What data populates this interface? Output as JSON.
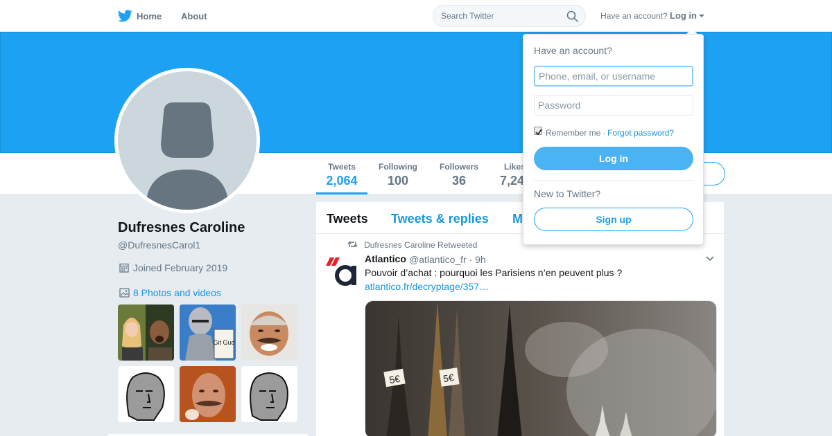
{
  "nav": {
    "home": "Home",
    "about": "About",
    "search_placeholder": "Search Twitter",
    "have_account": "Have an account?",
    "login": "Log in"
  },
  "profile": {
    "name": "Dufresnes Caroline",
    "handle": "@DufresnesCarol1",
    "joined": "Joined February 2019",
    "photos": "8 Photos and videos"
  },
  "stats": [
    {
      "label": "Tweets",
      "value": "2,064"
    },
    {
      "label": "Following",
      "value": "100"
    },
    {
      "label": "Followers",
      "value": "36"
    },
    {
      "label": "Likes",
      "value": "7,24"
    }
  ],
  "tabs": [
    "Tweets",
    "Tweets & replies",
    "M"
  ],
  "tweet": {
    "retweeted_by": "Dufresnes Caroline Retweeted",
    "author": "Atlantico",
    "meta": "@atlantico_fr · 9h",
    "text": "Pouvoir d’achat : pourquoi les Parisiens n’en peuvent plus ?",
    "link": "atlantico.fr/decryptage/357…",
    "price_tag": "5€"
  },
  "thumbs": {
    "git_gud": "Git Gud"
  },
  "login_dropdown": {
    "title": "Have an account?",
    "username_placeholder": "Phone, email, or username",
    "password_placeholder": "Password",
    "remember": "Remember me ·",
    "forgot": "Forgot password?",
    "login_button": "Log in",
    "new_prompt": "New to Twitter?",
    "signup_button": "Sign up"
  },
  "colors": {
    "brand": "#1da1f2",
    "link": "#1b95e0",
    "text_secondary": "#657786",
    "background": "#e6ecf0"
  }
}
